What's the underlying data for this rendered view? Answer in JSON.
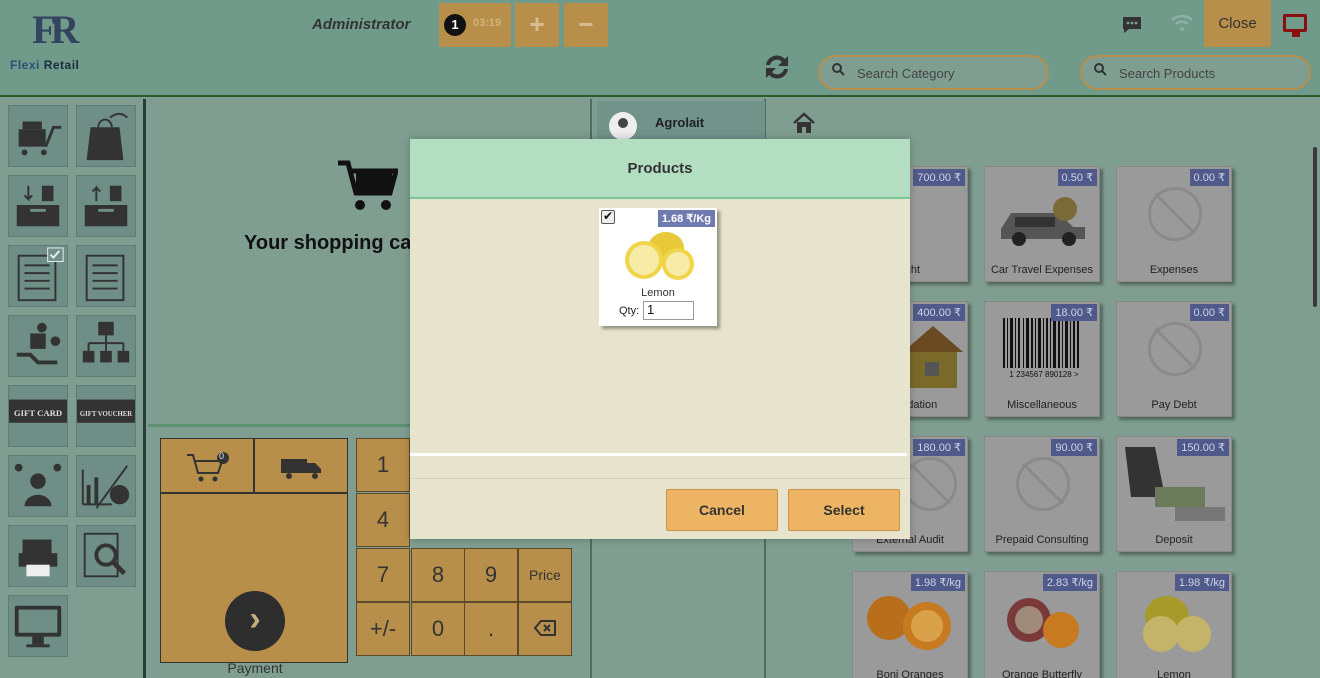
{
  "header": {
    "logo_mark": "FR",
    "logo_text_1": "Flexi",
    "logo_text_2": "Retail",
    "cashier": "Administrator",
    "order_number": "1",
    "order_time": "03:19",
    "add_label": "+",
    "remove_label": "−",
    "close_label": "Close",
    "search_category_placeholder": "Search Category",
    "search_products_placeholder": "Search Products"
  },
  "cart": {
    "empty_text": "Your shopping cart",
    "cart_badge": "0"
  },
  "numpad": {
    "keys": [
      "1",
      "4",
      "7",
      "8",
      "9",
      "Price",
      "+/-",
      "0",
      "."
    ],
    "payment_label": "Payment"
  },
  "customer": {
    "name": "Agrolait"
  },
  "products": [
    {
      "name": "light",
      "price": "700.00 ₹"
    },
    {
      "name": "Car Travel Expenses",
      "price": "0.50 ₹"
    },
    {
      "name": "Expenses",
      "price": "0.00 ₹"
    },
    {
      "name": "mmodation",
      "price": "400.00 ₹"
    },
    {
      "name": "Miscellaneous",
      "price": "18.00 ₹"
    },
    {
      "name": "Pay Debt",
      "price": "0.00 ₹"
    },
    {
      "name": "External Audit",
      "price": "180.00 ₹"
    },
    {
      "name": "Prepaid Consulting",
      "price": "90.00 ₹"
    },
    {
      "name": "Deposit",
      "price": "150.00 ₹"
    },
    {
      "name": "Boni Oranges",
      "price": "1.98 ₹/kg"
    },
    {
      "name": "Orange Butterfly",
      "price": "2.83 ₹/kg"
    },
    {
      "name": "Lemon",
      "price": "1.98 ₹/kg"
    }
  ],
  "barcode_digits": "1 234567 890128 >",
  "tools": {
    "gift_card": "GIFT CARD",
    "gift_voucher": "GIFT VOUCHER"
  },
  "modal": {
    "title": "Products",
    "item": {
      "name": "Lemon",
      "price": "1.68 ₹/Kg",
      "checked": "✔",
      "qty_label": "Qty:",
      "qty_value": "1"
    },
    "cancel_label": "Cancel",
    "select_label": "Select"
  }
}
